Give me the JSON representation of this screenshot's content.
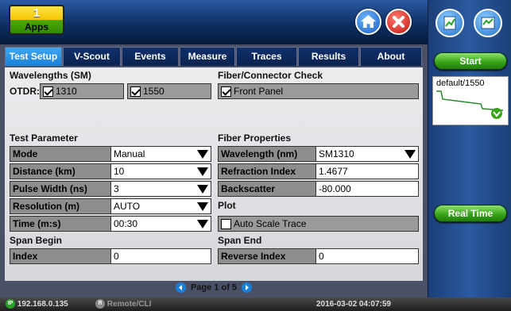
{
  "apps": {
    "count": "1",
    "label": "Apps"
  },
  "tabs": [
    "Test Setup",
    "V-Scout",
    "Events",
    "Measure",
    "Traces",
    "Results",
    "About"
  ],
  "sidebar": {
    "start": "Start",
    "thumbnail": "default/1550",
    "realtime": "Real Time"
  },
  "wavelengths": {
    "title": "Wavelengths (SM)",
    "otdr_label": "OTDR:",
    "w1": "1310",
    "w2": "1550"
  },
  "fiber_check": {
    "title": "Fiber/Connector Check",
    "front_panel": "Front Panel"
  },
  "test_param": {
    "title": "Test Parameter",
    "rows": [
      {
        "label": "Mode",
        "value": "Manual"
      },
      {
        "label": "Distance (km)",
        "value": "10"
      },
      {
        "label": "Pulse Width (ns)",
        "value": "3"
      },
      {
        "label": "Resolution (m)",
        "value": "AUTO"
      },
      {
        "label": "Time (m:s)",
        "value": "00:30"
      }
    ]
  },
  "fiber_props": {
    "title": "Fiber Properties",
    "wavelength_label": "Wavelength (nm)",
    "wavelength_value": "SM1310",
    "refraction_label": "Refraction Index",
    "refraction_value": "1.4677",
    "backscatter_label": "Backscatter",
    "backscatter_value": "-80.000"
  },
  "plot": {
    "title": "Plot",
    "auto_scale": "Auto Scale Trace"
  },
  "span_begin": {
    "title": "Span Begin",
    "label": "Index",
    "value": "0"
  },
  "span_end": {
    "title": "Span End",
    "label": "Reverse Index",
    "value": "0"
  },
  "pager": {
    "text": "Page 1 of 5"
  },
  "status": {
    "ip_icon": "IP",
    "ip": "192.168.0.135",
    "remote_icon": "R",
    "remote": "Remote/CLI",
    "datetime": "2016-03-02  04:07:59"
  }
}
